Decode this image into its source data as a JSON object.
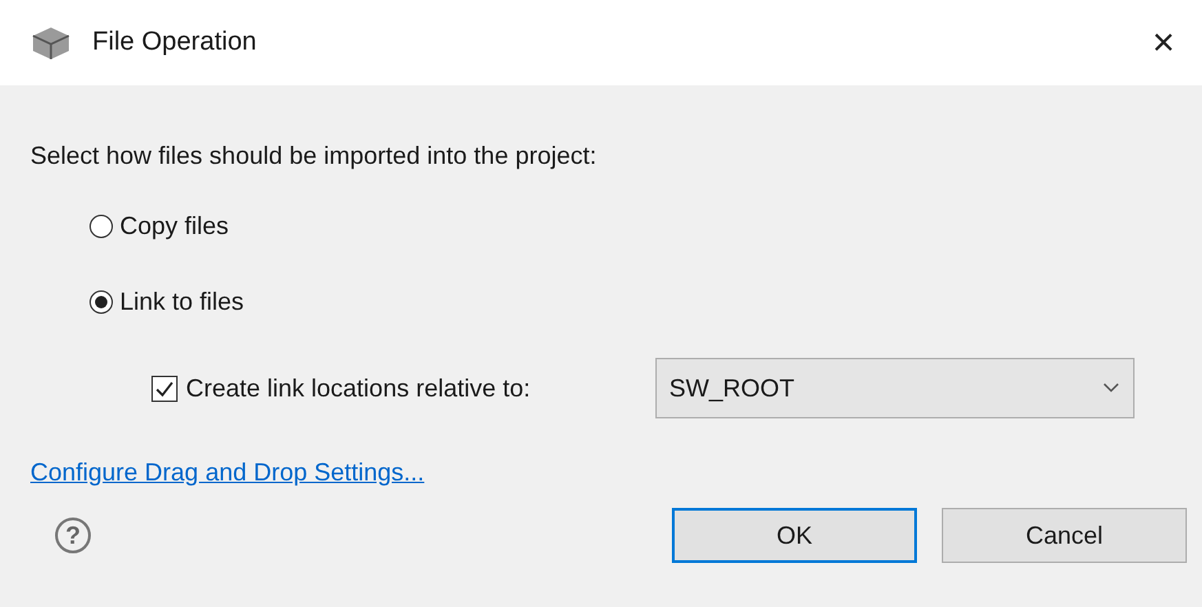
{
  "window": {
    "title": "File Operation",
    "close": "×"
  },
  "prompt": "Select how files should be imported into the project:",
  "options": [
    {
      "label": "Copy files",
      "selected": false
    },
    {
      "label": "Link to files",
      "selected": true
    }
  ],
  "relative": {
    "label": "Create link locations relative to:",
    "checked": true,
    "value": "SW_ROOT"
  },
  "link": "Configure Drag and Drop Settings...",
  "help": "?",
  "buttons": [
    {
      "label": "OK",
      "default": true
    },
    {
      "label": "Cancel",
      "default": false
    }
  ]
}
